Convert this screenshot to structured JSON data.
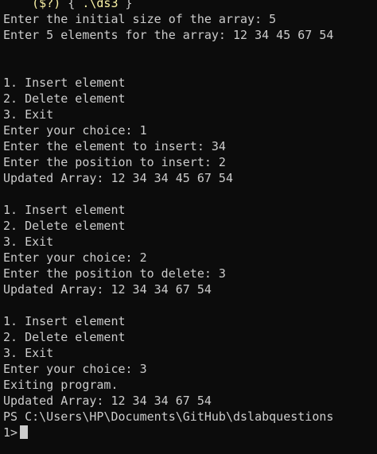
{
  "terminal": {
    "header_segments": [
      {
        "text": "    ",
        "color": "#cccccc"
      },
      {
        "text": "($?)",
        "color": "#f9f1a5"
      },
      {
        "text": " { ",
        "color": "#cccccc"
      },
      {
        "text": ".\\ds3",
        "color": "#f9f1a5"
      },
      {
        "text": " }",
        "color": "#cccccc"
      }
    ],
    "lines": [
      "Enter the initial size of the array: 5",
      "Enter 5 elements for the array: 12 34 45 67 54",
      "",
      "",
      "1. Insert element",
      "2. Delete element",
      "3. Exit",
      "Enter your choice: 1",
      "Enter the element to insert: 34",
      "Enter the position to insert: 2",
      "Updated Array: 12 34 34 45 67 54",
      "",
      "1. Insert element",
      "2. Delete element",
      "3. Exit",
      "Enter your choice: 2",
      "Enter the position to delete: 3",
      "Updated Array: 12 34 34 67 54",
      "",
      "1. Insert element",
      "2. Delete element",
      "3. Exit",
      "Enter your choice: 3",
      "Exiting program.",
      "Updated Array: 12 34 34 67 54",
      "PS C:\\Users\\HP\\Documents\\GitHub\\dslabquestions"
    ],
    "prompt": "1>",
    "colors": {
      "background": "#0c0c0c",
      "foreground": "#cccccc",
      "highlight": "#f9f1a5"
    }
  }
}
